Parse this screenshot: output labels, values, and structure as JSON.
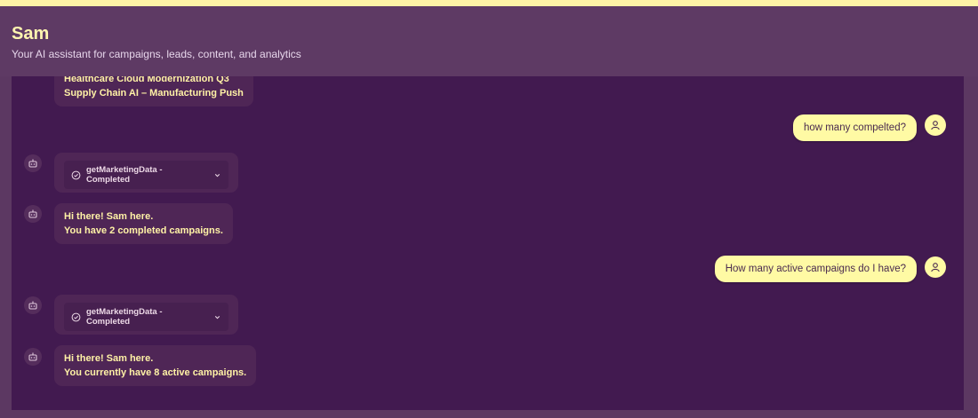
{
  "header": {
    "title": "Sam",
    "subtitle": "Your AI assistant for campaigns, leads, content, and analytics"
  },
  "messages": {
    "m0": {
      "lines": [
        "Healthcare Cloud Modernization Q3",
        "Supply Chain AI – Manufacturing Push"
      ]
    },
    "m1": {
      "text": "how many compelted?"
    },
    "m2": {
      "tool": "getMarketingData - Completed"
    },
    "m3": {
      "lines": [
        "Hi there! Sam here.",
        "You have 2 completed campaigns."
      ]
    },
    "m4": {
      "text": "How many active campaigns do I have?"
    },
    "m5": {
      "tool": "getMarketingData - Completed"
    },
    "m6": {
      "lines": [
        "Hi there! Sam here.",
        "You currently have 8 active campaigns."
      ]
    }
  },
  "icons": {
    "bot": "robot-icon",
    "user": "user-icon",
    "check": "check-circle-icon",
    "chevron": "chevron-down-icon"
  },
  "colors": {
    "accent": "#fffaa4",
    "chat_background": "#421a50",
    "header_background": "#5e3a64"
  }
}
